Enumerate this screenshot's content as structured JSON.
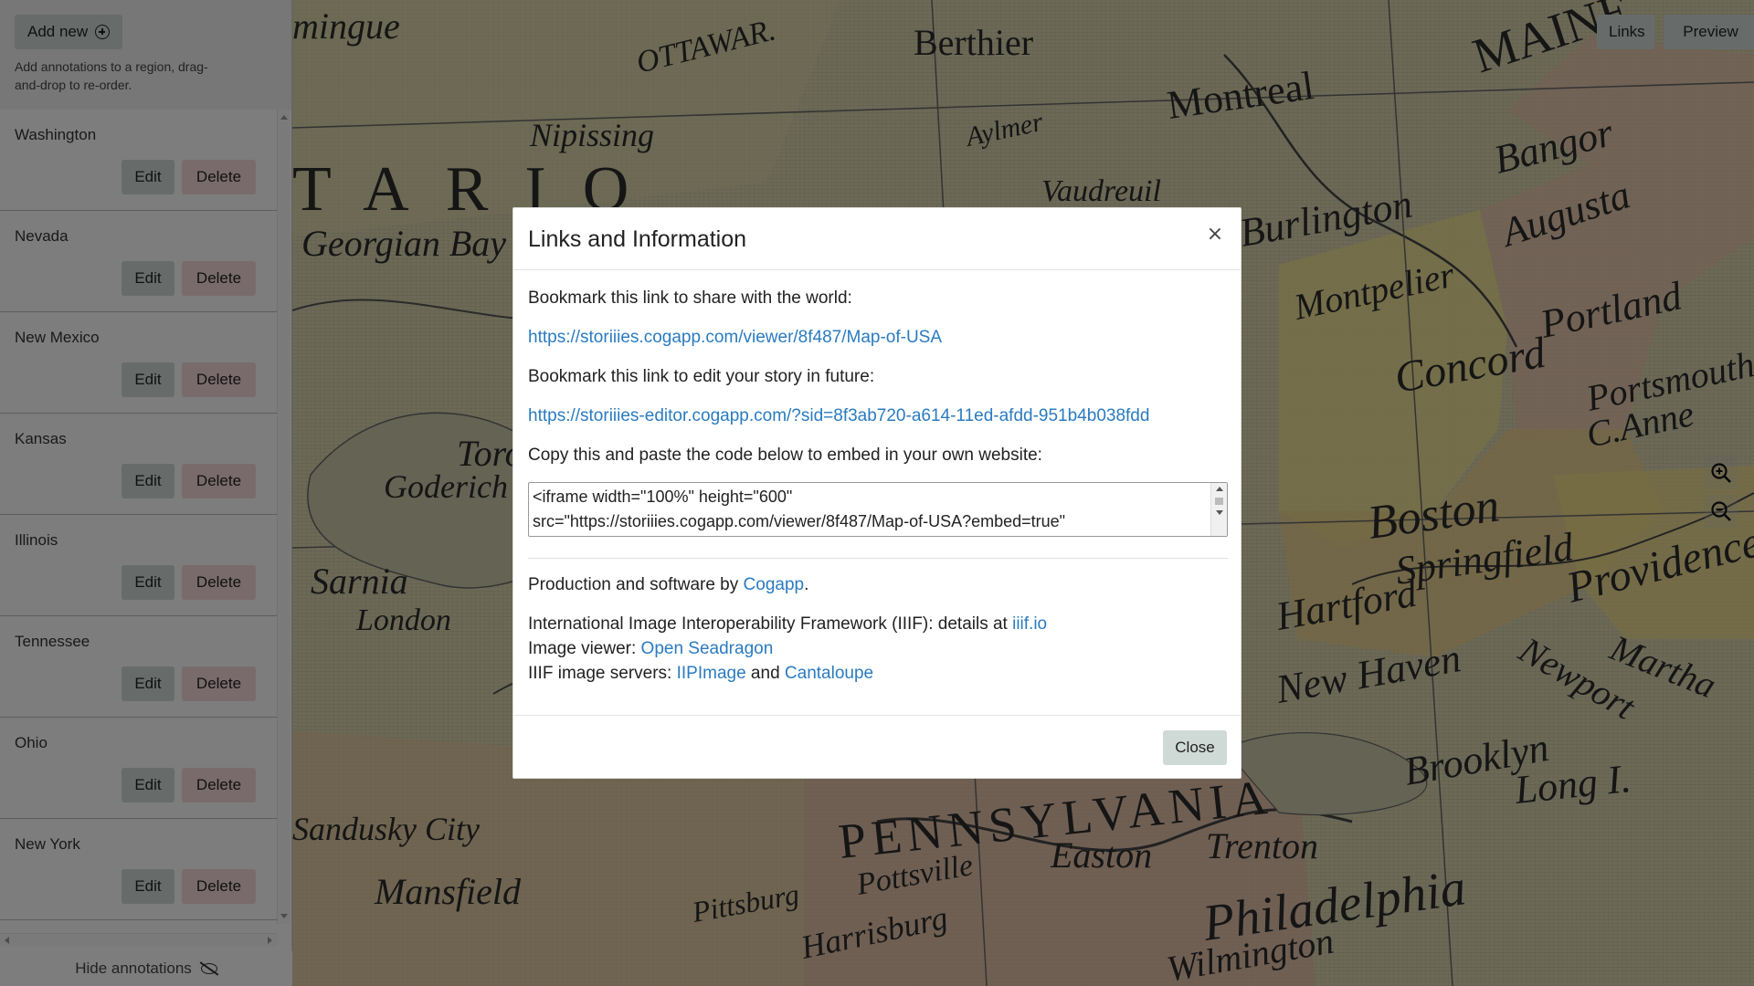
{
  "sidebar": {
    "add_new_label": "Add new",
    "hint": "Add annotations to a region, drag-and-drop to re-order.",
    "edit_label": "Edit",
    "delete_label": "Delete",
    "items": [
      {
        "title": "Washington"
      },
      {
        "title": "Nevada"
      },
      {
        "title": "New Mexico"
      },
      {
        "title": "Kansas"
      },
      {
        "title": "Illinois"
      },
      {
        "title": "Tennessee"
      },
      {
        "title": "Ohio"
      },
      {
        "title": "New York"
      }
    ],
    "hide_annotations_label": "Hide annotations"
  },
  "toolbar": {
    "links_label": "Links",
    "preview_label": "Preview"
  },
  "map": {
    "labels": [
      "mingue",
      "OTTAWAR.",
      "Berthier",
      "Montreal",
      "MAINE",
      "Nipissing",
      "Aylmer",
      "TARIO",
      "Bangor",
      "Augusta",
      "Georgian Bay",
      "Vaudreuil",
      "Burlington",
      "Montpelier",
      "Portland",
      "Portsmouth",
      "C.Anne",
      "Concord",
      "Toronto",
      "Goderich",
      "Boston",
      "Springfield",
      "Hartford",
      "Providence",
      "Sarnia",
      "London",
      "New Haven",
      "Newport",
      "Martha",
      "Brooklyn",
      "Long I.",
      "Trenton",
      "PENNSYLVANIA",
      "Pottsville",
      "Easton",
      "Philadelphia",
      "Pittsburg",
      "Harrisburg",
      "Mansfield",
      "Wilmington",
      "Sandusky City"
    ]
  },
  "modal": {
    "title": "Links and Information",
    "close_x": "×",
    "share_text": "Bookmark this link to share with the world:",
    "share_link": "https://storiiies.cogapp.com/viewer/8f487/Map-of-USA",
    "edit_text": "Bookmark this link to edit your story in future:",
    "edit_link": "https://storiiies-editor.cogapp.com/?sid=8f3ab720-a614-11ed-afdd-951b4b038fdd",
    "embed_text": "Copy this and paste the code below to embed in your own website:",
    "embed_code": "<iframe width=\"100%\" height=\"600\"\nsrc=\"https://storiiies.cogapp.com/viewer/8f487/Map-of-USA?embed=true\"",
    "production_prefix": "Production and software by ",
    "production_link": "Cogapp",
    "production_suffix": ".",
    "iiif_prefix": "International Image Interoperability Framework (IIIF): details at ",
    "iiif_link": "iiif.io",
    "viewer_prefix": "Image viewer: ",
    "viewer_link": "Open Seadragon",
    "servers_prefix": "IIIF image servers: ",
    "servers_link1": "IIPImage",
    "servers_and": " and ",
    "servers_link2": "Cantaloupe",
    "close_label": "Close"
  }
}
